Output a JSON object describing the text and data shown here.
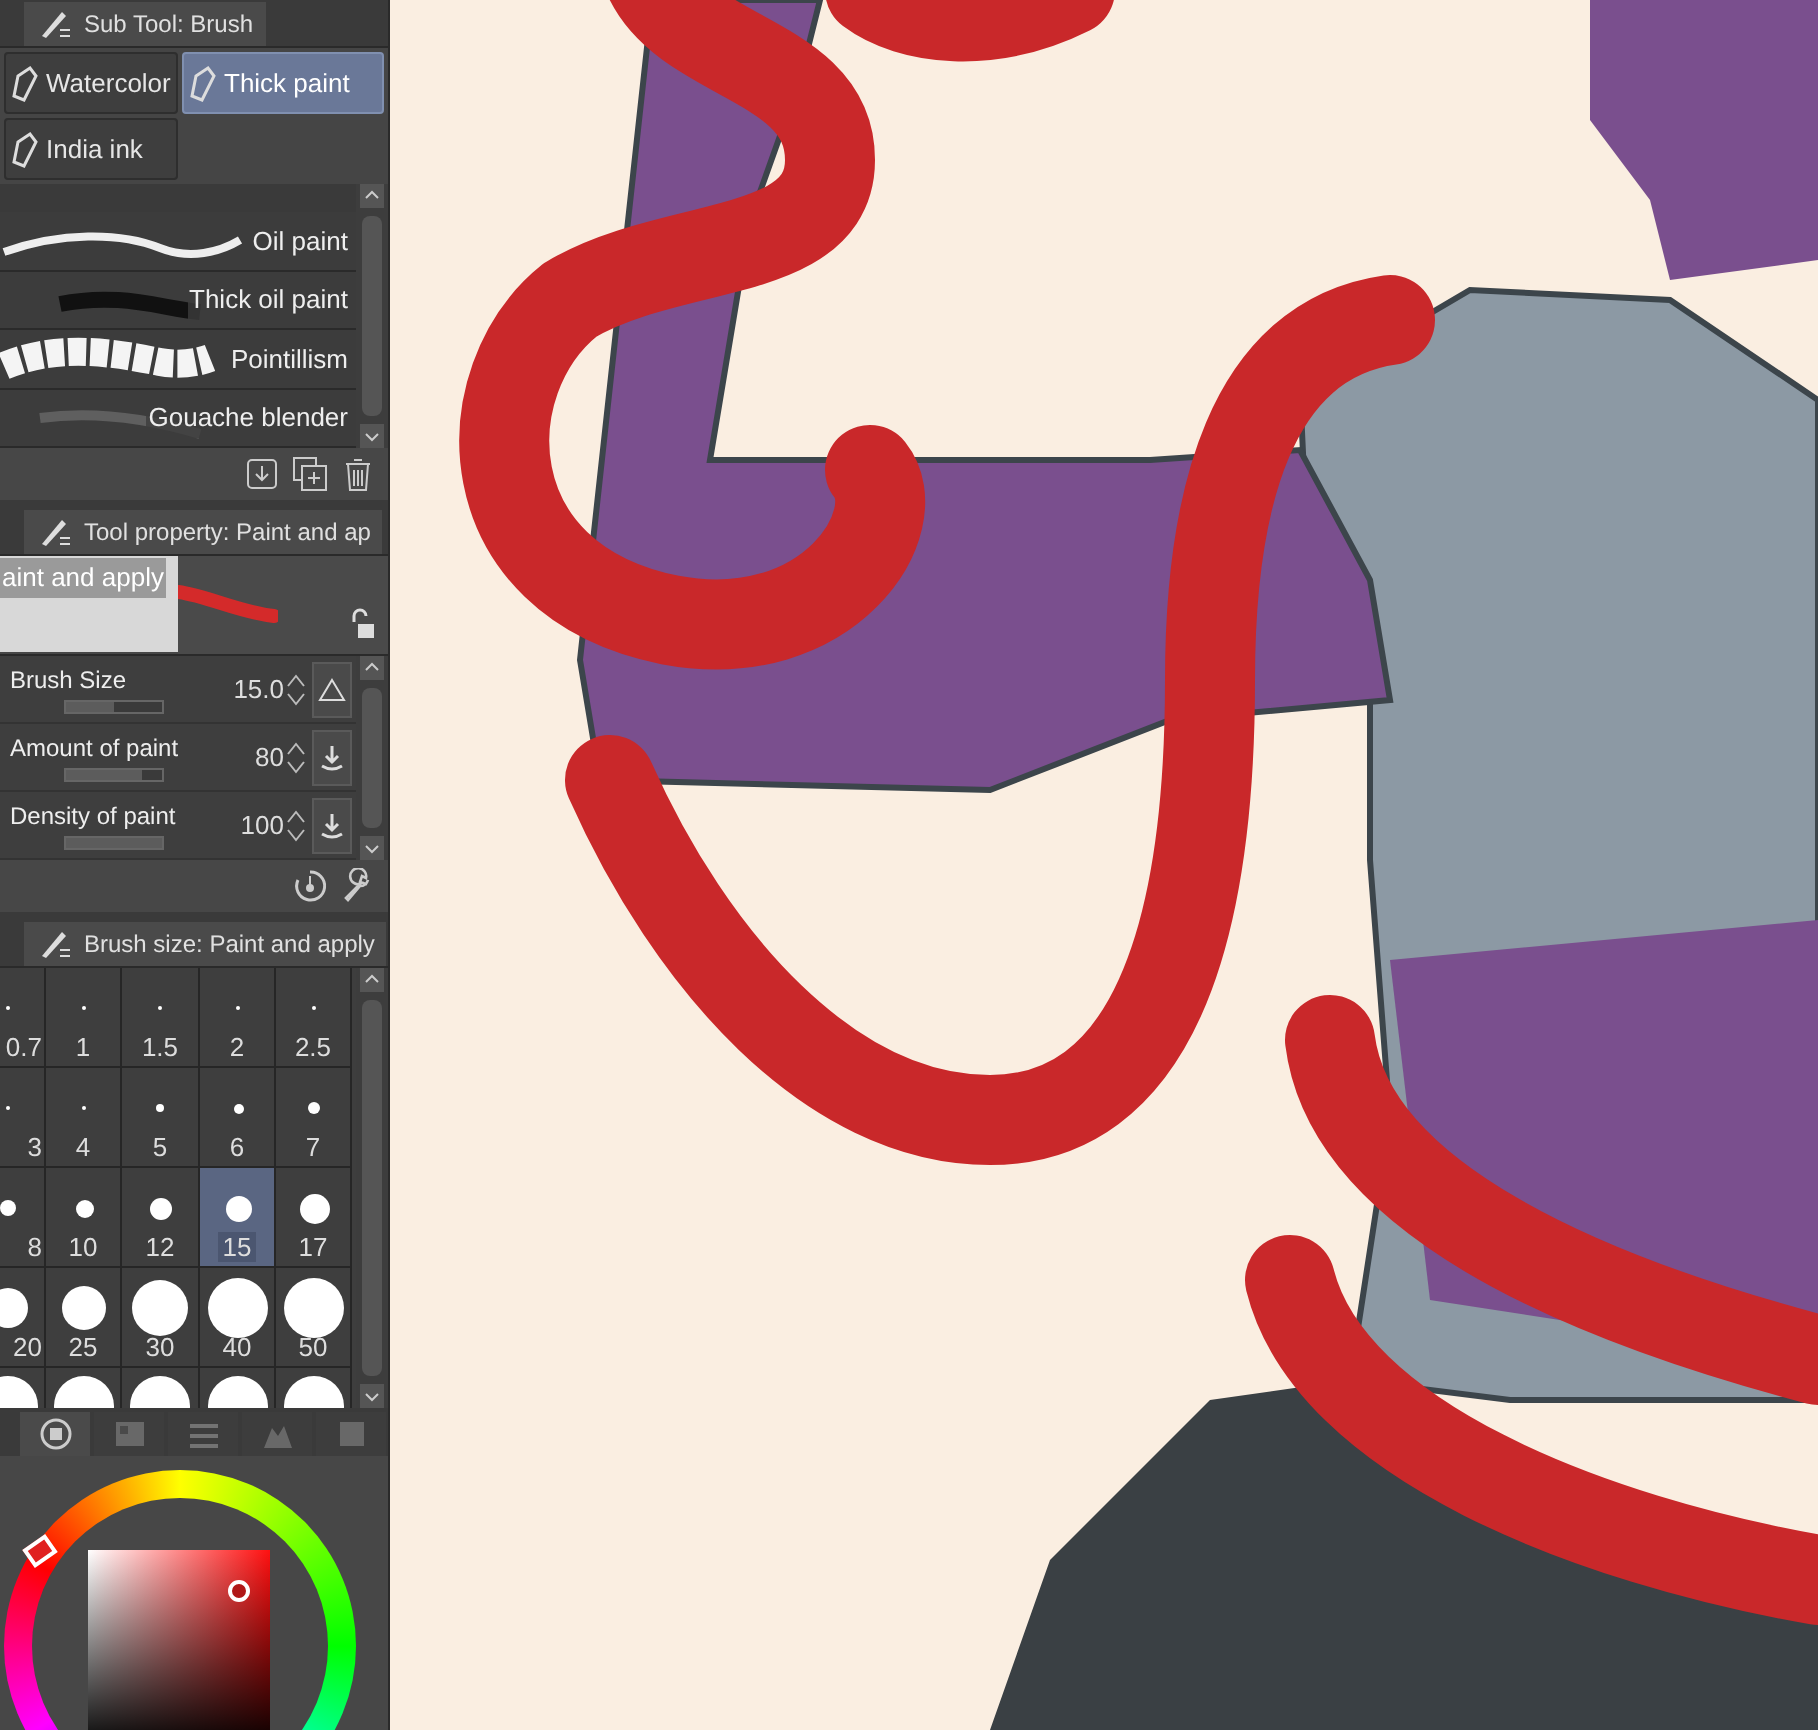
{
  "subtool_panel": {
    "title": "Sub Tool: Brush",
    "groups": [
      {
        "label": "Watercolor",
        "selected": false
      },
      {
        "label": "Thick paint",
        "selected": true
      },
      {
        "label": "India ink",
        "selected": false
      }
    ],
    "brushes": [
      {
        "name": "Oil paint",
        "kind": "light"
      },
      {
        "name": "Thick oil paint",
        "kind": "dark"
      },
      {
        "name": "Pointillism",
        "kind": "splatter"
      },
      {
        "name": "Gouache blender",
        "kind": "blend"
      }
    ]
  },
  "tool_property": {
    "title": "Tool property: Paint and ap",
    "preview_label": "aint and apply",
    "properties": [
      {
        "name": "Brush Size",
        "value": "15.0",
        "level": 0.5,
        "kind": "size"
      },
      {
        "name": "Amount of paint",
        "value": "80",
        "level": 0.8,
        "kind": "pressure"
      },
      {
        "name": "Density of paint",
        "value": "100",
        "level": 1.0,
        "kind": "pressure"
      }
    ]
  },
  "brush_size_panel": {
    "title": "Brush size: Paint and apply",
    "sizes": [
      {
        "label": "0.7",
        "selected": false
      },
      {
        "label": "1",
        "selected": false
      },
      {
        "label": "1.5",
        "selected": false
      },
      {
        "label": "2",
        "selected": false
      },
      {
        "label": "2.5",
        "selected": false
      },
      {
        "label": "3",
        "selected": false
      },
      {
        "label": "4",
        "selected": false
      },
      {
        "label": "5",
        "selected": false
      },
      {
        "label": "6",
        "selected": false
      },
      {
        "label": "7",
        "selected": false
      },
      {
        "label": "8",
        "selected": false
      },
      {
        "label": "10",
        "selected": false
      },
      {
        "label": "12",
        "selected": false
      },
      {
        "label": "15",
        "selected": true
      },
      {
        "label": "17",
        "selected": false
      },
      {
        "label": "20",
        "selected": false
      },
      {
        "label": "25",
        "selected": false
      },
      {
        "label": "30",
        "selected": false
      },
      {
        "label": "40",
        "selected": false
      },
      {
        "label": "50",
        "selected": false
      }
    ]
  },
  "color_panel": {
    "tabs": [
      {
        "kind": "wheel",
        "selected": true
      },
      {
        "kind": "set",
        "selected": false
      },
      {
        "kind": "slider",
        "selected": false
      },
      {
        "kind": "history",
        "selected": false
      },
      {
        "kind": "mixer",
        "selected": false
      }
    ]
  }
}
